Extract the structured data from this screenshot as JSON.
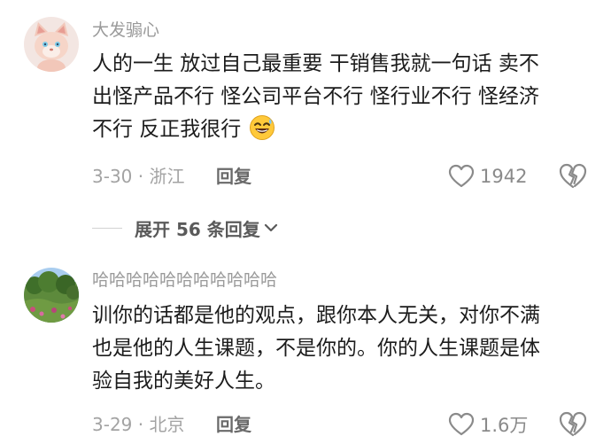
{
  "comments": [
    {
      "username": "大发骟心",
      "lines": [
        "人的一生 放过自己最重要 干销售我就一句话 卖不",
        "出怪产品不行 怪公司平台不行 怪行业不行 怪经济",
        "不行 反正我很行"
      ],
      "emoji": "grinning-sweat-emoji",
      "date_location": "3-30 · 浙江",
      "reply_label": "回复",
      "like_count": "1942"
    },
    {
      "username": "哈哈哈哈哈哈哈哈哈哈哈",
      "lines": [
        "训你的话都是他的观点，跟你本人无关，对你不满",
        "也是他的人生课题，不是你的。你的人生课题是体",
        "验自我的美好人生。"
      ],
      "date_location": "3-29 · 北京",
      "reply_label": "回复",
      "like_count": "1.6万"
    }
  ],
  "expand_replies": {
    "label": "展开 56 条回复"
  },
  "icons": {
    "like": "heart-outline-icon",
    "dislike": "broken-heart-icon",
    "expand": "chevron-down-icon"
  },
  "colors": {
    "text": "#1c1c1c",
    "meta": "#a3a3a3",
    "icon": "#8a8a8a",
    "emoji_face": "#ffc93a"
  }
}
